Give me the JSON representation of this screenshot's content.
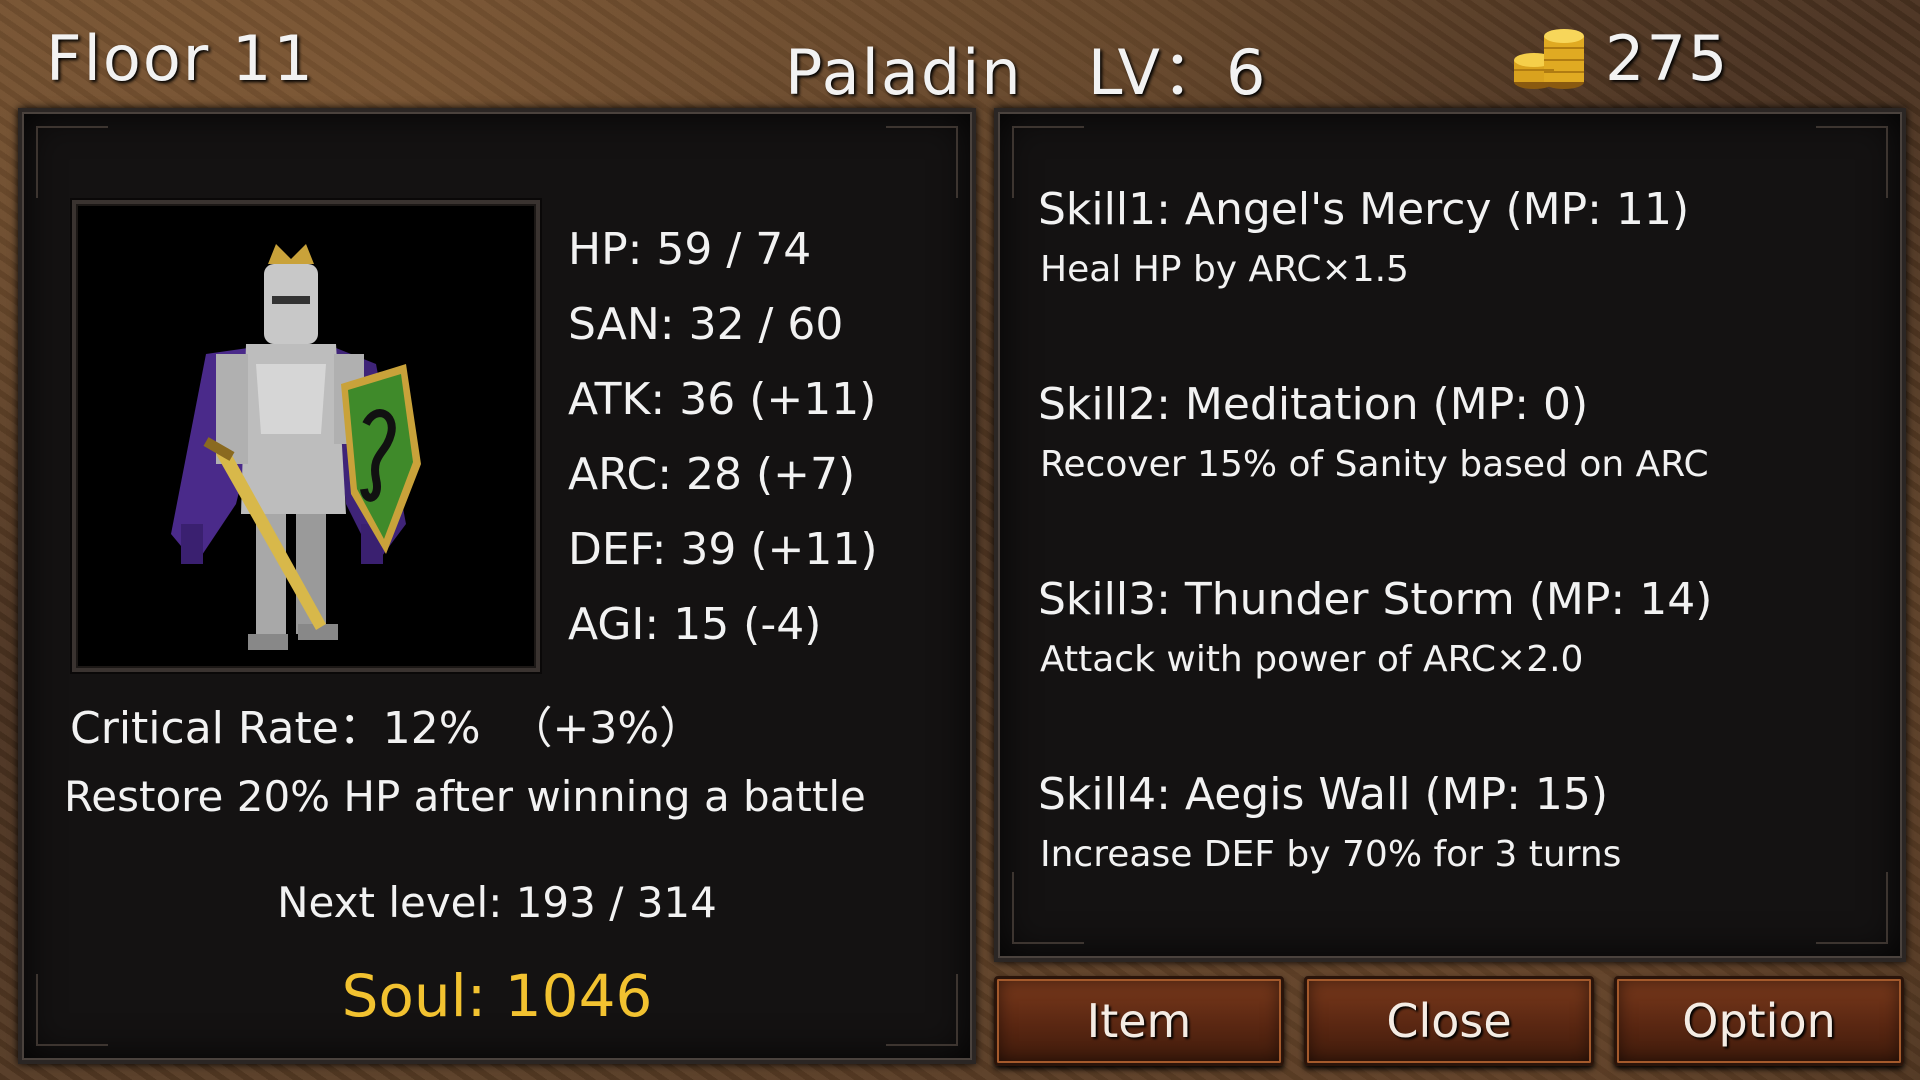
{
  "header": {
    "floor": "Floor 11",
    "class_level": "Paladin   LV：6",
    "gold": "275"
  },
  "character": {
    "stats": [
      "HP: 59 / 74",
      "SAN: 32 / 60",
      "ATK: 36 (+11)",
      "ARC: 28 (+7)",
      "DEF: 39 (+11)",
      "AGI: 15 (-4)"
    ],
    "critical_rate": "Critical Rate：12%  （+3%）",
    "passive": "Restore 20% HP after winning a battle",
    "next_level": "Next level: 193 / 314",
    "soul": "Soul: 1046"
  },
  "skills": [
    {
      "name": "Skill1: Angel's Mercy (MP: 11)",
      "desc": "Heal HP by ARC×1.5"
    },
    {
      "name": "Skill2: Meditation (MP: 0)",
      "desc": "Recover 15% of Sanity based on ARC"
    },
    {
      "name": "Skill3: Thunder Storm (MP: 14)",
      "desc": "Attack with power of ARC×2.0"
    },
    {
      "name": "Skill4: Aegis Wall (MP: 15)",
      "desc": "Increase DEF by 70% for 3 turns"
    }
  ],
  "buttons": {
    "item": "Item",
    "close": "Close",
    "option": "Option"
  },
  "colors": {
    "soul": "#f2c230",
    "button": "#5a2712",
    "panel": "#141212"
  }
}
